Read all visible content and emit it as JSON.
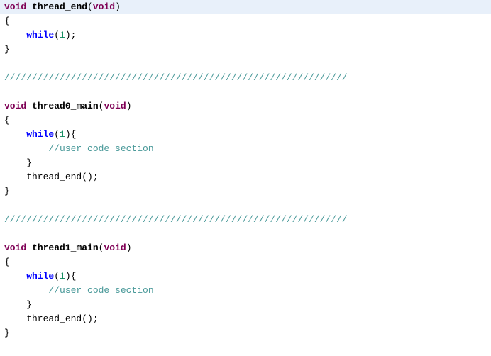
{
  "lines": [
    {
      "cls": "highlight",
      "tokens": [
        {
          "t": "void",
          "c": "kw"
        },
        {
          "t": " ",
          "c": ""
        },
        {
          "t": "thread_end",
          "c": "fn"
        },
        {
          "t": "(",
          "c": "paren"
        },
        {
          "t": "void",
          "c": "kw"
        },
        {
          "t": ")",
          "c": "paren"
        }
      ]
    },
    {
      "cls": "",
      "tokens": [
        {
          "t": "{",
          "c": "brace"
        }
      ]
    },
    {
      "cls": "",
      "tokens": [
        {
          "t": "    ",
          "c": ""
        },
        {
          "t": "while",
          "c": "kw2"
        },
        {
          "t": "(",
          "c": "paren"
        },
        {
          "t": "1",
          "c": "num"
        },
        {
          "t": ")",
          "c": "paren"
        },
        {
          "t": ";",
          "c": "semi"
        }
      ]
    },
    {
      "cls": "",
      "tokens": [
        {
          "t": "}",
          "c": "brace"
        }
      ]
    },
    {
      "cls": "",
      "tokens": [
        {
          "t": " ",
          "c": ""
        }
      ]
    },
    {
      "cls": "",
      "tokens": [
        {
          "t": "//////////////////////////////////////////////////////////////",
          "c": "comment"
        }
      ]
    },
    {
      "cls": "",
      "tokens": [
        {
          "t": " ",
          "c": ""
        }
      ]
    },
    {
      "cls": "",
      "tokens": [
        {
          "t": "void",
          "c": "kw"
        },
        {
          "t": " ",
          "c": ""
        },
        {
          "t": "thread0_main",
          "c": "fn"
        },
        {
          "t": "(",
          "c": "paren"
        },
        {
          "t": "void",
          "c": "kw"
        },
        {
          "t": ")",
          "c": "paren"
        }
      ]
    },
    {
      "cls": "",
      "tokens": [
        {
          "t": "{",
          "c": "brace"
        }
      ]
    },
    {
      "cls": "",
      "tokens": [
        {
          "t": "    ",
          "c": ""
        },
        {
          "t": "while",
          "c": "kw2"
        },
        {
          "t": "(",
          "c": "paren"
        },
        {
          "t": "1",
          "c": "num"
        },
        {
          "t": ")",
          "c": "paren"
        },
        {
          "t": "{",
          "c": "brace"
        }
      ]
    },
    {
      "cls": "",
      "tokens": [
        {
          "t": "        ",
          "c": ""
        },
        {
          "t": "//user code section",
          "c": "comment"
        }
      ]
    },
    {
      "cls": "",
      "tokens": [
        {
          "t": "    ",
          "c": ""
        },
        {
          "t": "}",
          "c": "brace"
        }
      ]
    },
    {
      "cls": "",
      "tokens": [
        {
          "t": "    thread_end();",
          "c": ""
        }
      ]
    },
    {
      "cls": "",
      "tokens": [
        {
          "t": "}",
          "c": "brace"
        }
      ]
    },
    {
      "cls": "",
      "tokens": [
        {
          "t": " ",
          "c": ""
        }
      ]
    },
    {
      "cls": "",
      "tokens": [
        {
          "t": "//////////////////////////////////////////////////////////////",
          "c": "comment"
        }
      ]
    },
    {
      "cls": "",
      "tokens": [
        {
          "t": " ",
          "c": ""
        }
      ]
    },
    {
      "cls": "",
      "tokens": [
        {
          "t": "void",
          "c": "kw"
        },
        {
          "t": " ",
          "c": ""
        },
        {
          "t": "thread1_main",
          "c": "fn"
        },
        {
          "t": "(",
          "c": "paren"
        },
        {
          "t": "void",
          "c": "kw"
        },
        {
          "t": ")",
          "c": "paren"
        }
      ]
    },
    {
      "cls": "",
      "tokens": [
        {
          "t": "{",
          "c": "brace"
        }
      ]
    },
    {
      "cls": "",
      "tokens": [
        {
          "t": "    ",
          "c": ""
        },
        {
          "t": "while",
          "c": "kw2"
        },
        {
          "t": "(",
          "c": "paren"
        },
        {
          "t": "1",
          "c": "num"
        },
        {
          "t": ")",
          "c": "paren"
        },
        {
          "t": "{",
          "c": "brace"
        }
      ]
    },
    {
      "cls": "",
      "tokens": [
        {
          "t": "        ",
          "c": ""
        },
        {
          "t": "//user code section",
          "c": "comment"
        }
      ]
    },
    {
      "cls": "",
      "tokens": [
        {
          "t": "    ",
          "c": ""
        },
        {
          "t": "}",
          "c": "brace"
        }
      ]
    },
    {
      "cls": "",
      "tokens": [
        {
          "t": "    thread_end();",
          "c": ""
        }
      ]
    },
    {
      "cls": "",
      "tokens": [
        {
          "t": "}",
          "c": "brace"
        }
      ]
    }
  ]
}
